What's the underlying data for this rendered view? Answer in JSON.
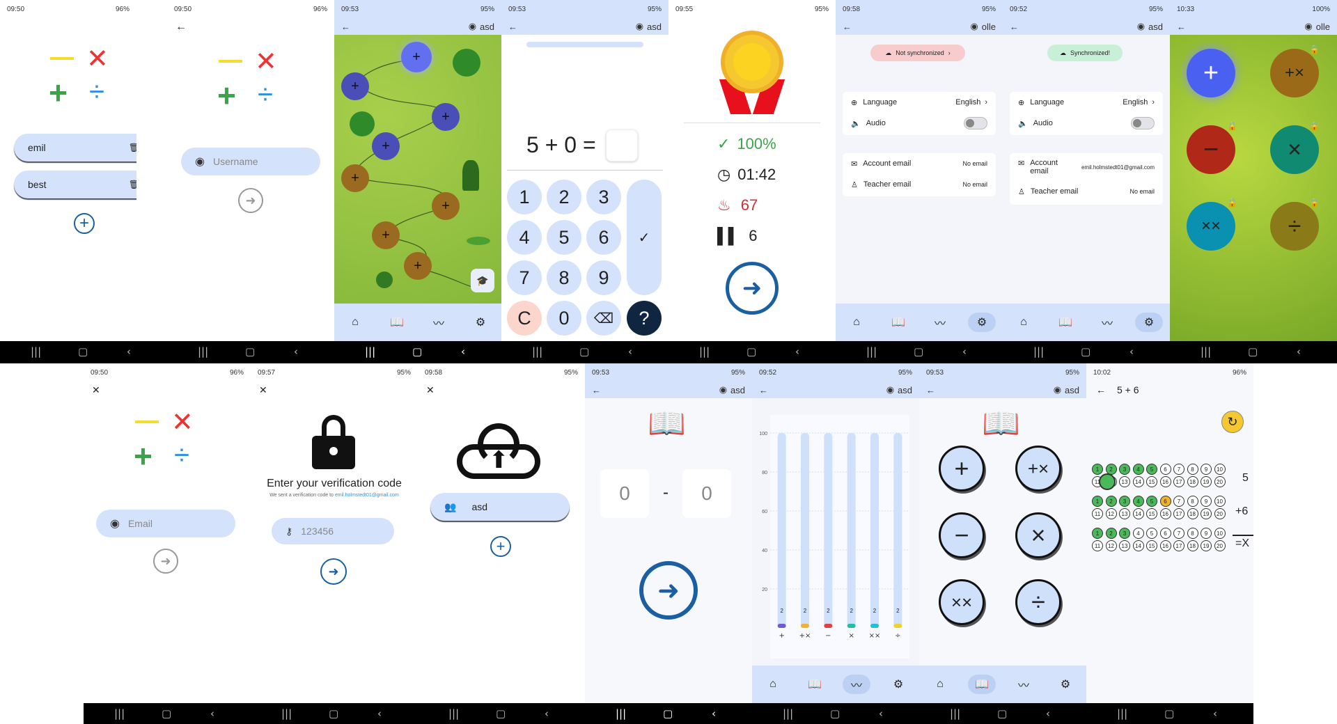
{
  "s1": {
    "time": "09:50",
    "status": "96%",
    "users": [
      "emil",
      "best"
    ]
  },
  "s2": {
    "time": "09:50",
    "status": "96%",
    "placeholder": "Username"
  },
  "s3": {
    "time": "09:53",
    "status": "95%",
    "user": "asd"
  },
  "s4": {
    "time": "09:53",
    "status": "95%",
    "user": "asd",
    "equation": "5 + 0 =",
    "keys": [
      "1",
      "2",
      "3",
      "4",
      "5",
      "6",
      "7",
      "8",
      "9",
      "C",
      "0",
      "?"
    ]
  },
  "s5": {
    "time": "09:55",
    "status": "95%",
    "accuracy": "100%",
    "duration": "01:42",
    "streak": "67",
    "level": "6"
  },
  "s6": {
    "time": "09:58",
    "status": "95%",
    "user": "olle",
    "sync": "Not synchronized",
    "language_label": "Language",
    "language_value": "English",
    "audio_label": "Audio",
    "account_email_label": "Account email",
    "account_email_value": "No email",
    "teacher_email_label": "Teacher email",
    "teacher_email_value": "No email"
  },
  "s7": {
    "time": "09:52",
    "status": "95%",
    "user": "asd",
    "sync": "Synchronized!",
    "language_label": "Language",
    "language_value": "English",
    "audio_label": "Audio",
    "account_email_label": "Account email",
    "account_email_value": "emil.holmstedt01@gmail.com",
    "teacher_email_label": "Teacher email",
    "teacher_email_value": "No email"
  },
  "s8": {
    "time": "10:33",
    "status": "100%",
    "user": "olle"
  },
  "s9": {
    "time": "09:50",
    "status": "96%",
    "placeholder": "Email"
  },
  "s10": {
    "time": "09:57",
    "status": "95%",
    "title": "Enter your verification code",
    "subtitle": "We sent a verification code to",
    "email": "emil.holmstedt01@gmail.com",
    "placeholder": "123456"
  },
  "s11": {
    "time": "09:58",
    "status": "95%",
    "user": "asd"
  },
  "s12": {
    "time": "09:53",
    "status": "95%",
    "user": "asd",
    "left": "0",
    "dash": "-",
    "right": "0"
  },
  "s13": {
    "time": "09:52",
    "status": "95%",
    "user": "asd"
  },
  "s14": {
    "time": "09:53",
    "status": "95%",
    "user": "asd"
  },
  "s15": {
    "time": "10:02",
    "status": "96%",
    "title": "5 + 6",
    "num1": "5",
    "num2": "+6",
    "result": "=X"
  },
  "chart_data": {
    "type": "bar",
    "categories": [
      "+",
      "+×",
      "−",
      "×",
      "××",
      "÷"
    ],
    "values": [
      2,
      2,
      2,
      2,
      2,
      2
    ],
    "ylim": [
      0,
      100
    ],
    "yticks": [
      20,
      40,
      60,
      80,
      100
    ],
    "bar_colors": [
      "#6b5bd6",
      "#f0b030",
      "#e04040",
      "#20c0a0",
      "#20c0d8",
      "#f0d030"
    ]
  }
}
